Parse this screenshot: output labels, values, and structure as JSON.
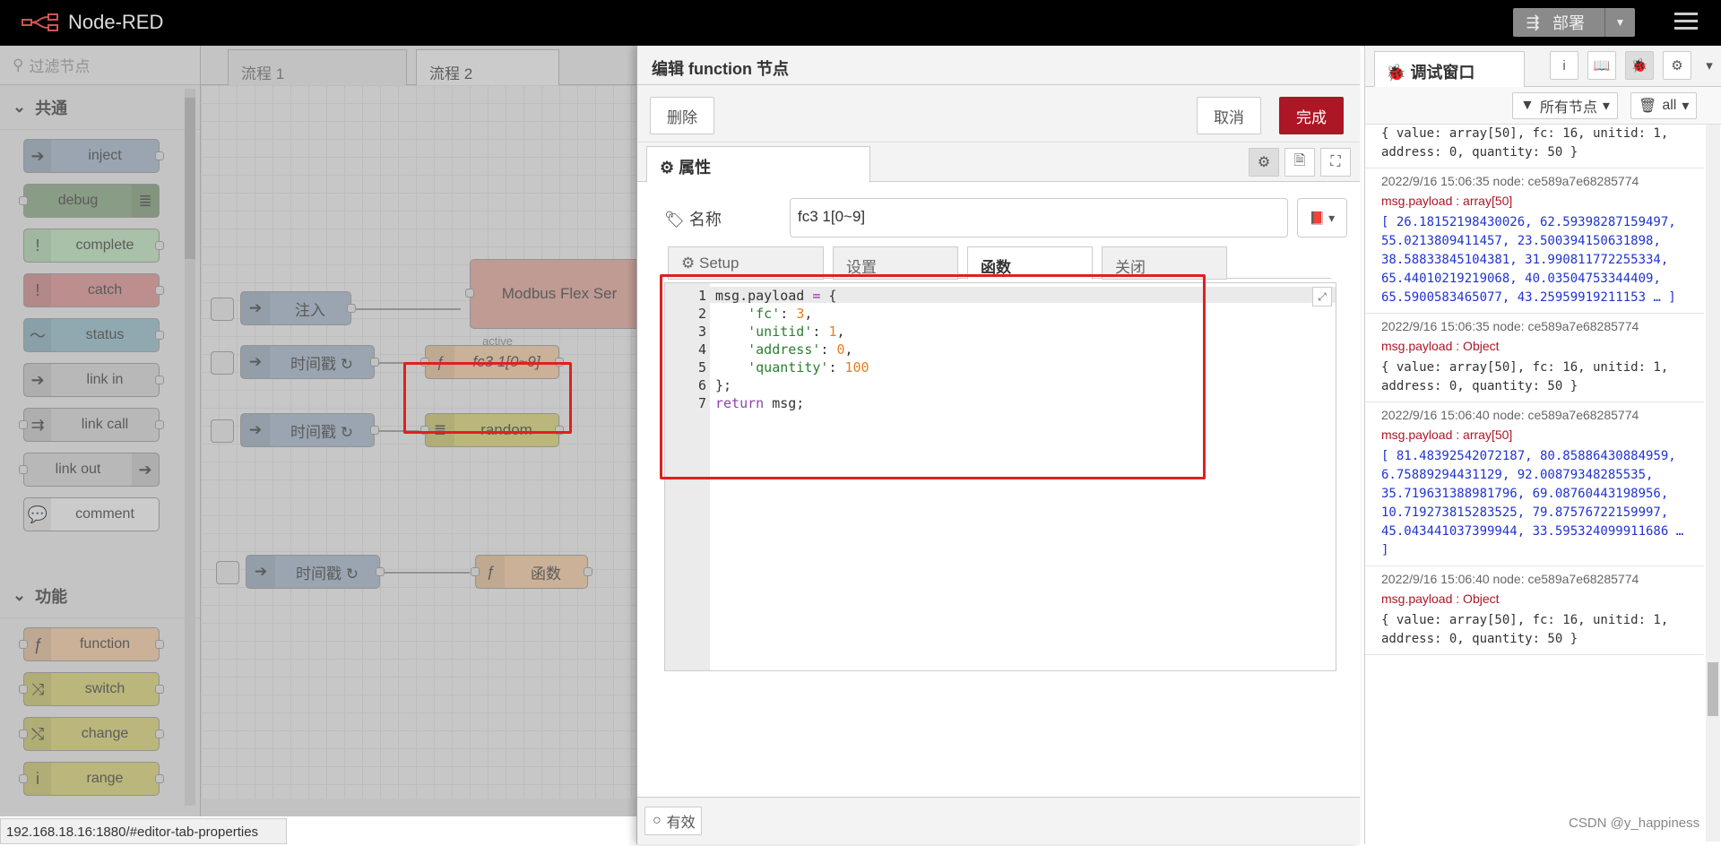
{
  "header": {
    "title": "Node-RED",
    "deploy_label": "部署"
  },
  "palette": {
    "filter_placeholder": "过滤节点",
    "categories": [
      "共通",
      "功能"
    ],
    "common_nodes": [
      "inject",
      "debug",
      "complete",
      "catch",
      "status",
      "link in",
      "link call",
      "link out",
      "comment"
    ],
    "function_nodes": [
      "function",
      "switch",
      "change",
      "range"
    ]
  },
  "workspace": {
    "tabs": [
      "流程 1",
      "流程 2"
    ],
    "nodes": {
      "inject1": "注入",
      "modbus": "Modbus Flex Ser",
      "ts1": "时间戳 ↻",
      "fc3": "fc3 1[0~9]",
      "ts2": "时间戳 ↻",
      "random": "random",
      "ts3": "时间戳 ↻",
      "func": "函数",
      "active": "active"
    }
  },
  "status_url": "192.168.18.16:1880/#editor-tab-properties",
  "tray": {
    "title": "编辑 function 节点",
    "delete_label": "删除",
    "cancel_label": "取消",
    "done_label": "完成",
    "props_tab": "属性",
    "name_label": "名称",
    "name_value": "fc3 1[0~9]",
    "subtabs": [
      "Setup",
      "设置",
      "函数",
      "关闭"
    ],
    "code_lines": [
      "1",
      "2",
      "3",
      "4",
      "5",
      "6",
      "7"
    ],
    "valid_label": "有效"
  },
  "sidebar": {
    "tab_label": "调试窗口",
    "filter_label": "所有节点",
    "clear_label": "all",
    "messages": [
      {
        "meta": "",
        "topic": "",
        "value": "{ value: array[50], fc: 16, unitid: 1, address: 0, quantity: 50 }"
      },
      {
        "meta": "2022/9/16 15:06:35   node: ce589a7e68285774",
        "topic": "msg.payload : array[50]",
        "value": "[ 26.18152198430026, 62.59398287159497, 55.0213809411457, 23.500394150631898, 38.58833845104381, 31.990811772255334, 65.44010219219068, 40.03504753344409, 65.5900583465077, 43.25959919211153 … ]"
      },
      {
        "meta": "2022/9/16 15:06:35   node: ce589a7e68285774",
        "topic": "msg.payload : Object",
        "value": "{ value: array[50], fc: 16, unitid: 1, address: 0, quantity: 50 }"
      },
      {
        "meta": "2022/9/16 15:06:40   node: ce589a7e68285774",
        "topic": "msg.payload : array[50]",
        "value": "[ 81.48392542072187, 80.85886430884959, 6.75889294431129, 92.00879348285535, 35.719631388981796, 69.08760443198956, 10.719273815283525, 79.87576722159997, 45.043441037399944, 33.595324099911686 … ]"
      },
      {
        "meta": "2022/9/16 15:06:40   node: ce589a7e68285774",
        "topic": "msg.payload : Object",
        "value": "{ value: array[50], fc: 16, unitid: 1, address: 0, quantity: 50 }"
      }
    ]
  },
  "watermark": "CSDN @y_happiness"
}
